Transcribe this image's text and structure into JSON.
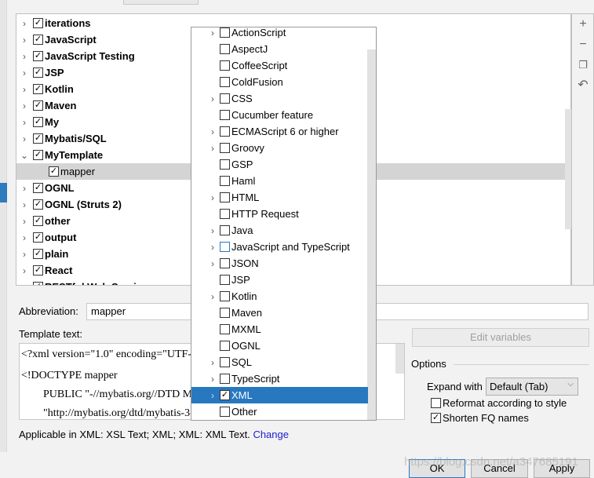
{
  "tree": {
    "items": [
      {
        "label": "iterations",
        "checked": true,
        "expand": "collapsed"
      },
      {
        "label": "JavaScript",
        "checked": true,
        "expand": "collapsed"
      },
      {
        "label": "JavaScript Testing",
        "checked": true,
        "expand": "collapsed"
      },
      {
        "label": "JSP",
        "checked": true,
        "expand": "collapsed"
      },
      {
        "label": "Kotlin",
        "checked": true,
        "expand": "collapsed"
      },
      {
        "label": "Maven",
        "checked": true,
        "expand": "collapsed"
      },
      {
        "label": "My",
        "checked": true,
        "expand": "collapsed"
      },
      {
        "label": "Mybatis/SQL",
        "checked": true,
        "expand": "collapsed"
      },
      {
        "label": "MyTemplate",
        "checked": true,
        "expand": "expanded"
      },
      {
        "label": "mapper",
        "checked": true,
        "child": true,
        "selected": true
      },
      {
        "label": "OGNL",
        "checked": true,
        "expand": "collapsed"
      },
      {
        "label": "OGNL (Struts 2)",
        "checked": true,
        "expand": "collapsed"
      },
      {
        "label": "other",
        "checked": true,
        "expand": "collapsed"
      },
      {
        "label": "output",
        "checked": true,
        "expand": "collapsed"
      },
      {
        "label": "plain",
        "checked": true,
        "expand": "collapsed"
      },
      {
        "label": "React",
        "checked": true,
        "expand": "collapsed"
      },
      {
        "label": "RESTful Web Services",
        "checked": true,
        "expand": "collapsed"
      }
    ]
  },
  "toolbar": {
    "icons": [
      "plus-icon",
      "minus-icon",
      "copy-icon",
      "revert-icon"
    ]
  },
  "popup": {
    "items": [
      {
        "label": "ActionScript",
        "arrow": true,
        "checked": false
      },
      {
        "label": "AspectJ",
        "arrow": false,
        "checked": false
      },
      {
        "label": "CoffeeScript",
        "arrow": false,
        "checked": false
      },
      {
        "label": "ColdFusion",
        "arrow": false,
        "checked": false
      },
      {
        "label": "CSS",
        "arrow": true,
        "checked": false
      },
      {
        "label": "Cucumber feature",
        "arrow": false,
        "checked": false
      },
      {
        "label": "ECMAScript 6 or higher",
        "arrow": true,
        "checked": false
      },
      {
        "label": "Groovy",
        "arrow": true,
        "checked": false
      },
      {
        "label": "GSP",
        "arrow": false,
        "checked": false
      },
      {
        "label": "Haml",
        "arrow": false,
        "checked": false
      },
      {
        "label": "HTML",
        "arrow": true,
        "checked": false
      },
      {
        "label": "HTTP Request",
        "arrow": false,
        "checked": false
      },
      {
        "label": "Java",
        "arrow": true,
        "checked": false
      },
      {
        "label": "JavaScript and TypeScript",
        "arrow": true,
        "checked": false
      },
      {
        "label": "JSON",
        "arrow": true,
        "checked": false
      },
      {
        "label": "JSP",
        "arrow": false,
        "checked": false
      },
      {
        "label": "Kotlin",
        "arrow": true,
        "checked": false
      },
      {
        "label": "Maven",
        "arrow": false,
        "checked": false
      },
      {
        "label": "MXML",
        "arrow": false,
        "checked": false
      },
      {
        "label": "OGNL",
        "arrow": false,
        "checked": false
      },
      {
        "label": "SQL",
        "arrow": true,
        "checked": false
      },
      {
        "label": "TypeScript",
        "arrow": true,
        "checked": false
      },
      {
        "label": "XML",
        "arrow": true,
        "checked": true,
        "selected": true
      },
      {
        "label": "Other",
        "arrow": false,
        "checked": false
      }
    ]
  },
  "form": {
    "abbreviation_label": "Abbreviation:",
    "abbreviation_value": "mapper",
    "template_text_label": "Template text:",
    "template_lines": [
      "<?xml version=\"1.0\" encoding=\"UTF-8\" ?>",
      "<!DOCTYPE mapper",
      "        PUBLIC \"-//mybatis.org//DTD Mapper 3.0//EN\"",
      "        \"http://mybatis.org/dtd/mybatis-3-mapper.dtd\">"
    ],
    "edit_variables": "Edit variables",
    "options_label": "Options",
    "expand_with_label": "Expand with",
    "expand_with_value": "Default (Tab)",
    "reformat_label": "Reformat according to style",
    "reformat_checked": false,
    "shorten_label": "Shorten FQ names",
    "shorten_checked": true,
    "applicable_text": "Applicable in XML: XSL Text; XML; XML: XML Text.",
    "change_link": "Change"
  },
  "buttons": {
    "ok": "OK",
    "cancel": "Cancel",
    "apply": "Apply"
  },
  "watermark": "https://blog.csdn.net/a347685191"
}
